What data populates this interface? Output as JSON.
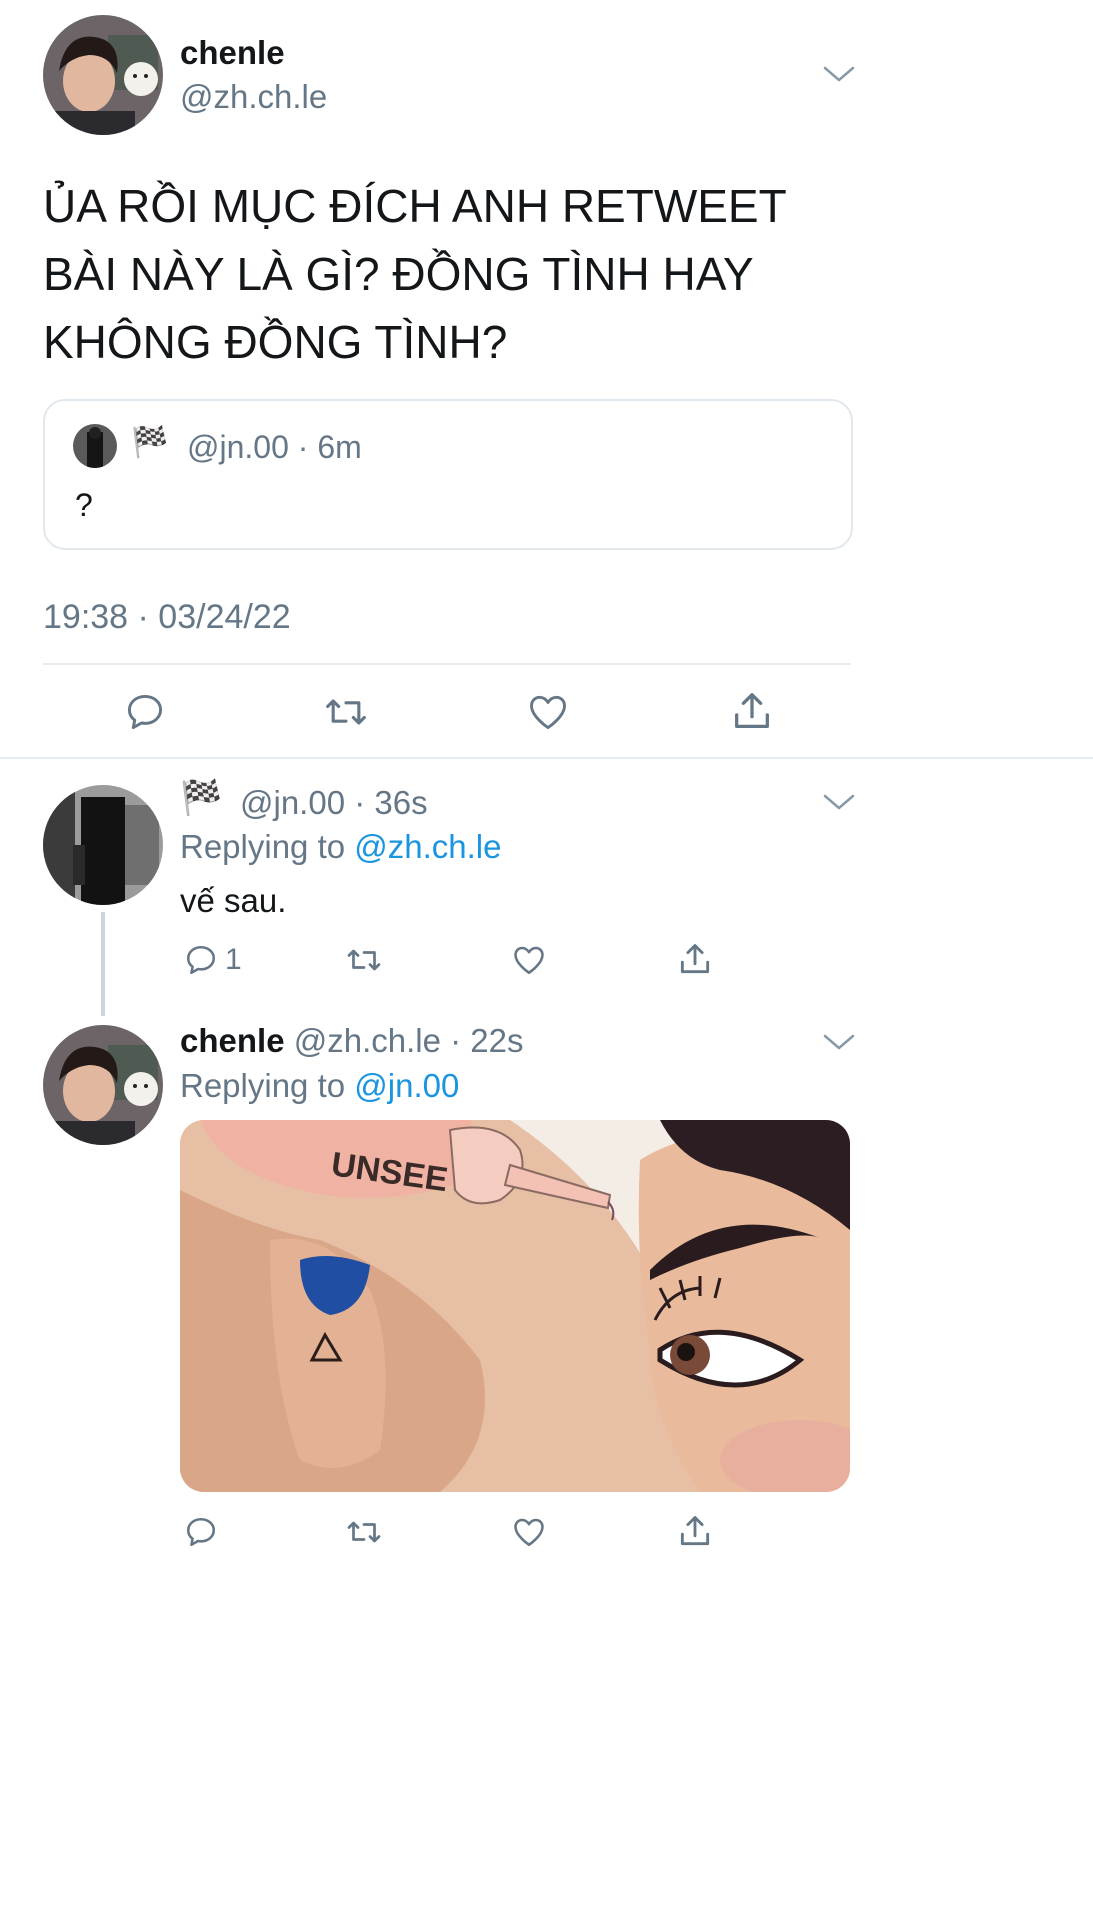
{
  "main_tweet": {
    "display_name": "chenle",
    "handle": "@zh.ch.le",
    "text_lines": [
      "ỦA RỒI MỤC ĐÍCH ANH RETWEET",
      "BÀI NÀY LÀ GÌ? ĐỒNG TÌNH HAY",
      "KHÔNG ĐỒNG TÌNH?"
    ],
    "quoted": {
      "flag": "🏁",
      "handle_time": "@jn.00 · 6m",
      "text": "?"
    },
    "timestamp": "19:38 · 03/24/22"
  },
  "reply1": {
    "flag": "🏁",
    "handle_time": "@jn.00 · 36s",
    "replying_prefix": "Replying to ",
    "replying_to": "@zh.ch.le",
    "text": "vế sau.",
    "reply_count": "1"
  },
  "reply2": {
    "display_name": "chenle",
    "handle_time": "@zh.ch.le · 22s",
    "replying_prefix": "Replying to ",
    "replying_to": "@jn.00",
    "image_text": "UNSEE"
  },
  "icons": {
    "reply": "reply-icon",
    "retweet": "retweet-icon",
    "like": "heart-icon",
    "share": "share-icon",
    "more": "chevron-down-icon"
  },
  "colors": {
    "link": "#1b95e0",
    "muted": "#657786",
    "border": "#e1e8ed"
  }
}
